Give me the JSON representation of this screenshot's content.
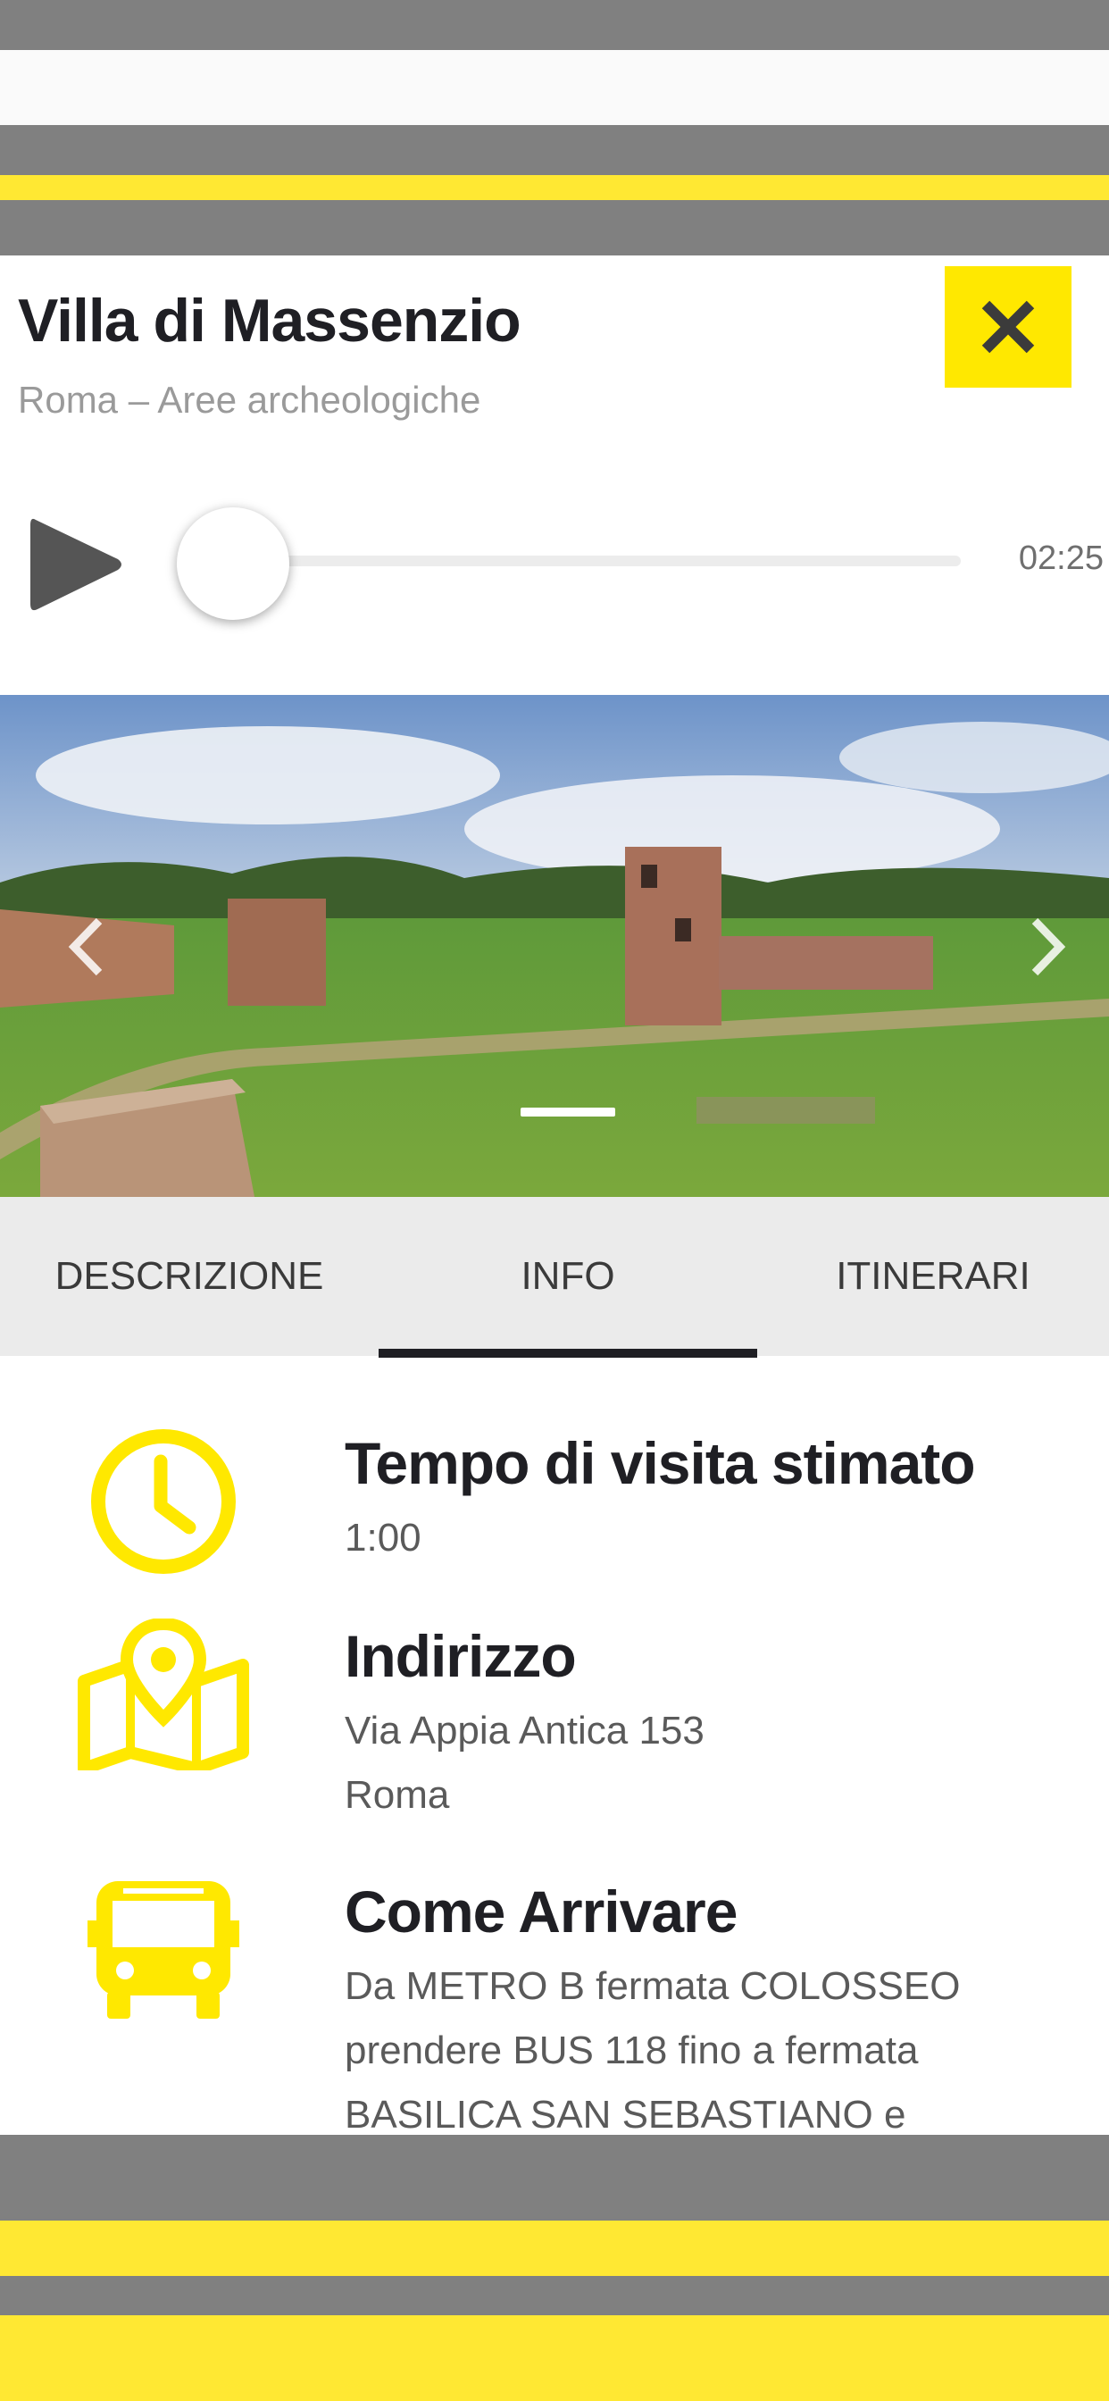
{
  "poi": {
    "title": "Villa di Massenzio",
    "subtitle": "Roma – Aree archeologiche"
  },
  "player": {
    "duration": "02:25",
    "progress": 0
  },
  "tabs": [
    "DESCRIZIONE",
    "INFO",
    "ITINERARI"
  ],
  "active_tab": "INFO",
  "info": {
    "time": {
      "title": "Tempo di visita stimato",
      "value": "1:00"
    },
    "address": {
      "title": "Indirizzo",
      "line1": "Via Appia Antica 153",
      "line2": "Roma"
    },
    "directions": {
      "title": "Come Arrivare",
      "line1": "Da METRO B fermata COLOSSEO",
      "line2": "prendere BUS 118 fino a fermata",
      "line3": "BASILICA SAN SEBASTIANO e"
    }
  },
  "icons": {
    "close": "close-icon",
    "play": "play-icon",
    "prev": "chevron-left-icon",
    "next": "chevron-right-icon",
    "time": "clock-icon",
    "address": "map-pin-icon",
    "directions": "bus-icon"
  },
  "colors": {
    "accent": "#ffe800",
    "chrome_gray": "#808080",
    "text_dark": "#1f1f24"
  }
}
